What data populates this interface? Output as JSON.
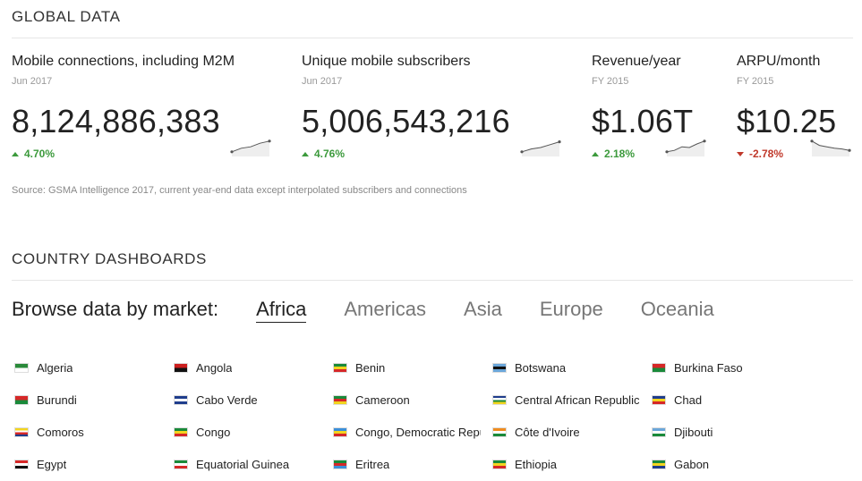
{
  "global": {
    "title": "GLOBAL DATA",
    "stats": [
      {
        "label": "Mobile connections, including M2M",
        "date": "Jun 2017",
        "value": "8,124,886,383",
        "change": "4.70%",
        "direction": "up",
        "trend": [
          0.2,
          0.45,
          0.55,
          0.8,
          0.95
        ]
      },
      {
        "label": "Unique mobile subscribers",
        "date": "Jun 2017",
        "value": "5,006,543,216",
        "change": "4.76%",
        "direction": "up",
        "trend": [
          0.2,
          0.4,
          0.5,
          0.7,
          0.9
        ]
      },
      {
        "label": "Revenue/year",
        "date": "FY 2015",
        "value": "$1.06T",
        "change": "2.18%",
        "direction": "up",
        "trend": [
          0.2,
          0.3,
          0.55,
          0.5,
          0.75,
          0.95
        ]
      },
      {
        "label": "ARPU/month",
        "date": "FY 2015",
        "value": "$10.25",
        "change": "-2.78%",
        "direction": "down",
        "trend": [
          0.95,
          0.65,
          0.55,
          0.45,
          0.4,
          0.3
        ]
      }
    ],
    "source": "Source: GSMA Intelligence 2017, current year-end data except interpolated subscribers and connections"
  },
  "dashboards": {
    "title": "COUNTRY DASHBOARDS",
    "browse_label": "Browse data by market:",
    "regions": [
      "Africa",
      "Americas",
      "Asia",
      "Europe",
      "Oceania"
    ],
    "active_region": "Africa",
    "countries": [
      {
        "name": "Algeria",
        "colors": [
          "#2a8a3a",
          "#ffffff"
        ]
      },
      {
        "name": "Angola",
        "colors": [
          "#cc1f1f",
          "#111111"
        ]
      },
      {
        "name": "Benin",
        "colors": [
          "#1a8a3a",
          "#f2d41f",
          "#d62828"
        ]
      },
      {
        "name": "Botswana",
        "colors": [
          "#6aa6d9",
          "#111111",
          "#6aa6d9"
        ]
      },
      {
        "name": "Burkina Faso",
        "colors": [
          "#d62828",
          "#1a8a3a"
        ]
      },
      {
        "name": "Burundi",
        "colors": [
          "#d62828",
          "#1a8a3a"
        ]
      },
      {
        "name": "Cabo Verde",
        "colors": [
          "#1f3d8c",
          "#ffffff",
          "#1f3d8c"
        ]
      },
      {
        "name": "Cameroon",
        "colors": [
          "#1a8a3a",
          "#d62828",
          "#f2d41f"
        ]
      },
      {
        "name": "Central African Republic",
        "colors": [
          "#1f3d8c",
          "#ffffff",
          "#1a8a3a",
          "#f2d41f"
        ]
      },
      {
        "name": "Chad",
        "colors": [
          "#1f3d8c",
          "#f2d41f",
          "#d62828"
        ]
      },
      {
        "name": "Comoros",
        "colors": [
          "#f2d41f",
          "#ffffff",
          "#d62828",
          "#1f3d8c"
        ]
      },
      {
        "name": "Congo",
        "colors": [
          "#1a8a3a",
          "#f2d41f",
          "#d62828"
        ]
      },
      {
        "name": "Congo, Democratic Republic",
        "colors": [
          "#3b8fd9",
          "#f2d41f",
          "#d62828"
        ]
      },
      {
        "name": "Côte d'Ivoire",
        "colors": [
          "#f08c1f",
          "#ffffff",
          "#1a8a3a"
        ]
      },
      {
        "name": "Djibouti",
        "colors": [
          "#6aa6d9",
          "#ffffff",
          "#1a8a3a"
        ]
      },
      {
        "name": "Egypt",
        "colors": [
          "#d62828",
          "#ffffff",
          "#111111"
        ]
      },
      {
        "name": "Equatorial Guinea",
        "colors": [
          "#1a8a3a",
          "#ffffff",
          "#d62828"
        ]
      },
      {
        "name": "Eritrea",
        "colors": [
          "#1a8a3a",
          "#d62828",
          "#3b8fd9"
        ]
      },
      {
        "name": "Ethiopia",
        "colors": [
          "#1a8a3a",
          "#f2d41f",
          "#d62828"
        ]
      },
      {
        "name": "Gabon",
        "colors": [
          "#1a8a3a",
          "#f2d41f",
          "#1f3d8c"
        ]
      }
    ]
  },
  "colors": {
    "up": "#3c9a3c",
    "down": "#c0392b",
    "spark": "#555555",
    "spark_fill": "#eeeeee"
  }
}
